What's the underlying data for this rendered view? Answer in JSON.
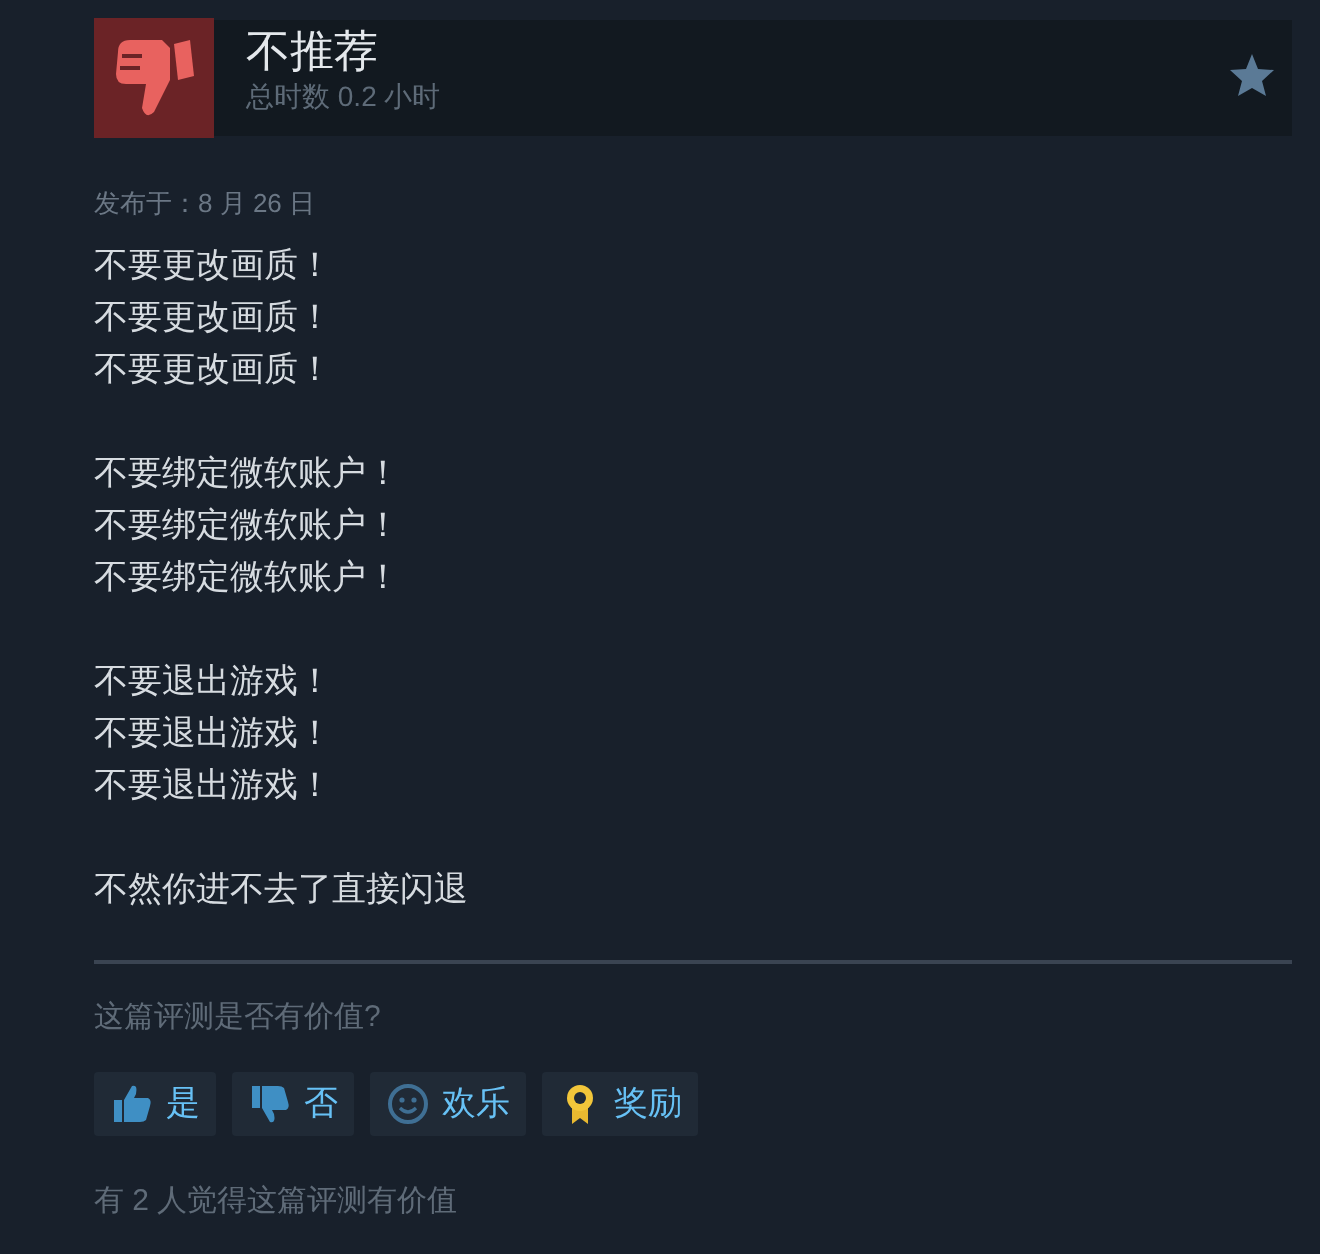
{
  "review": {
    "verdict": {
      "kind": "not_recommended",
      "title": "不推荐"
    },
    "playtime": "总时数 0.2 小时",
    "posted": "发布于：8 月 26 日",
    "paragraphs": [
      [
        "不要更改画质！",
        "不要更改画质！",
        "不要更改画质！"
      ],
      [
        "不要绑定微软账户！",
        "不要绑定微软账户！",
        "不要绑定微软账户！"
      ],
      [
        "不要退出游戏！",
        "不要退出游戏！",
        "不要退出游戏！"
      ],
      [
        "不然你进不去了直接闪退"
      ]
    ],
    "helpful_question": "这篇评测是否有价值?",
    "buttons": [
      {
        "kind": "yes",
        "label": "是"
      },
      {
        "kind": "no",
        "label": "否"
      },
      {
        "kind": "funny",
        "label": "欢乐"
      },
      {
        "kind": "award",
        "label": "奖励"
      }
    ],
    "helpful_count": "有 2 人觉得这篇评测有价值"
  }
}
